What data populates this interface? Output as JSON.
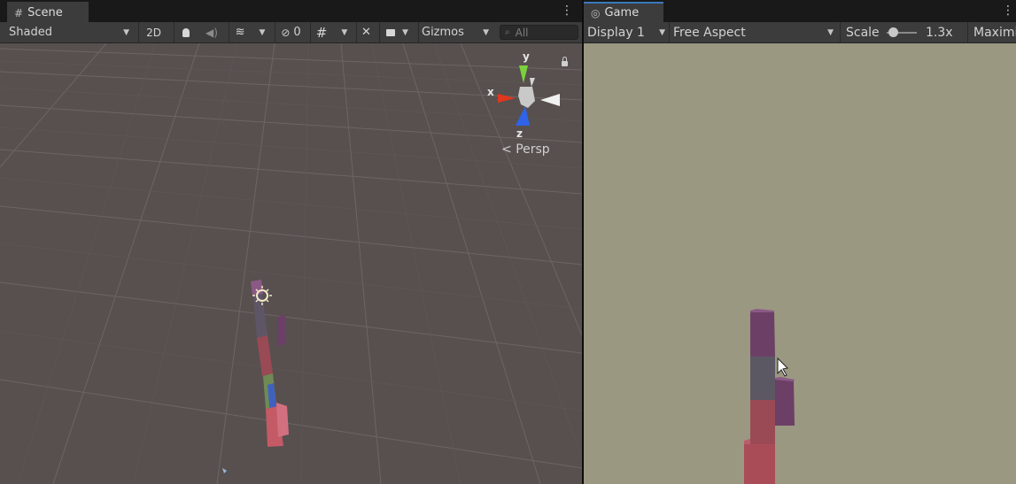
{
  "scene": {
    "tab_label": "Scene",
    "shading_mode": "Shaded",
    "mode_2d": "2D",
    "hidden_count": "0",
    "gizmos_label": "Gizmos",
    "search_placeholder": "All",
    "gizmo_axes": {
      "y": "y",
      "x": "x",
      "z": "z"
    },
    "projection_label": "Persp"
  },
  "game": {
    "tab_label": "Game",
    "display": "Display 1",
    "aspect": "Free Aspect",
    "scale_label": "Scale",
    "scale_value": "1.3x",
    "maximize_label": "Maximi"
  },
  "colors": {
    "scene_bg": "#57504f",
    "game_bg": "#9b9882",
    "block_purple": "#6c3f66",
    "block_grey": "#5b5864",
    "block_red": "#9a4a55",
    "axis_x": "#e0371d",
    "axis_y": "#7bd23d",
    "axis_z": "#2f63e8",
    "tab_accent": "#3a79bb"
  }
}
